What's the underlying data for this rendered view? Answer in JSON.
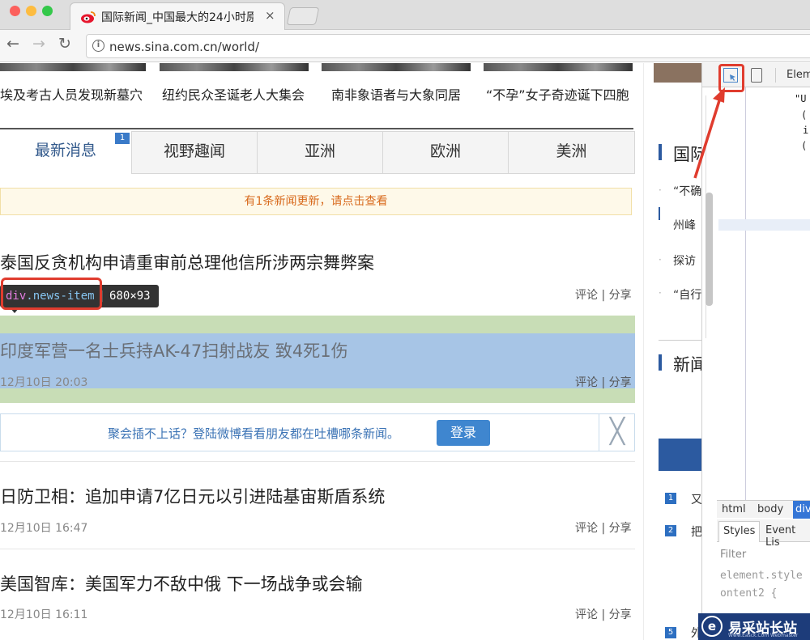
{
  "browser": {
    "tab_title": "国际新闻_中国最大的24小时原创",
    "tab_close": "×",
    "url": "news.sina.com.cn/world/",
    "back": "←",
    "forward": "→",
    "reload": "↻",
    "info": "i"
  },
  "photo_captions": [
    "埃及考古人员发现新墓穴",
    "纽约民众圣诞老人大集会",
    "南非象语者与大象同居",
    "“不孕”女子奇迹诞下四胞"
  ],
  "news_tabs": {
    "items": [
      "最新消息",
      "视野趣闻",
      "亚洲",
      "欧洲",
      "美洲"
    ],
    "active_index": 0,
    "badge": "1"
  },
  "update_notice": "有1条新闻更新，请点击查看",
  "tooltip": {
    "tag": "div",
    "class": ".news-item",
    "size": "680×93"
  },
  "news_items": [
    {
      "title": "泰国反贪机构申请重审前总理他信所涉两宗舞弊案",
      "date": "",
      "actions": "评论 | 分享"
    },
    {
      "title": "印度军营一名士兵持AK-47扫射战友 致4死1伤",
      "date": "12月10日 20:03",
      "actions": "评论 | 分享"
    },
    {
      "title": "日防卫相：追加申请7亿日元以引进陆基宙斯盾系统",
      "date": "12月10日 16:47",
      "actions": "评论 | 分享"
    },
    {
      "title": "美国智库：美国军力不敌中俄 下一场战争或会输",
      "date": "12月10日 16:11",
      "actions": "评论 | 分享"
    }
  ],
  "weibo_bar": {
    "text": "聚会插不上话？登陆微博看看朋友都在吐槽哪条新闻。",
    "login": "登录",
    "close": "╳"
  },
  "right_column": {
    "section1_title": "国际",
    "items": [
      "“不确",
      "州峰",
      "探访",
      "“自行"
    ],
    "section2_title": "新闻",
    "ranks": [
      {
        "num": "1",
        "text": "又"
      },
      {
        "num": "2",
        "text": "把"
      },
      {
        "num": "5",
        "text": "外"
      }
    ]
  },
  "devtools": {
    "tab": "Elem",
    "dom_snippet": [
      "\"U",
      "(",
      "i",
      "("
    ],
    "crumbs": [
      "html",
      "body",
      "div"
    ],
    "style_tabs": [
      "Styles",
      "Event Lis"
    ],
    "filter": "Filter",
    "style_lines": [
      "element.style",
      "ontent2 {"
    ]
  },
  "watermark": {
    "logo": "e",
    "title": "易采站长站",
    "subtitle": "Www.Easck.Com Webmaster"
  },
  "colors": {
    "highlight_content": "#a7c5e6",
    "highlight_margin": "#c8ddb6",
    "annotation_red": "#e03c2e",
    "accent_blue": "#2c5aa0"
  }
}
